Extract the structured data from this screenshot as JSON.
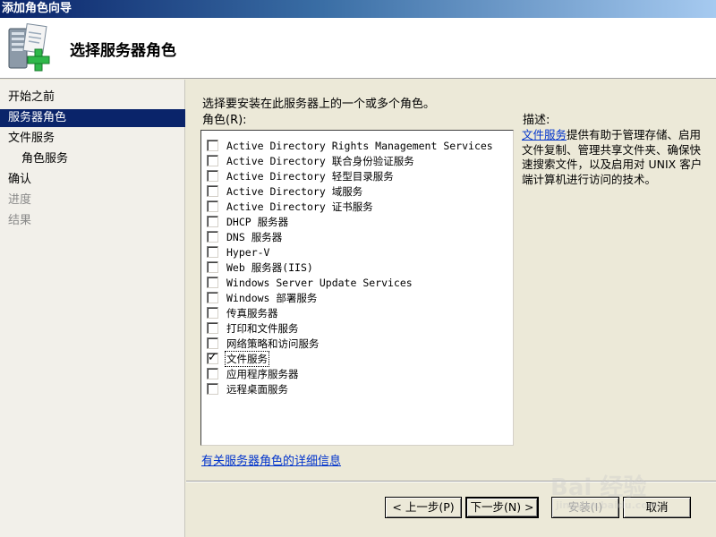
{
  "window": {
    "title": "添加角色向导"
  },
  "header": {
    "title": "选择服务器角色"
  },
  "sidebar": {
    "items": [
      {
        "label": "开始之前",
        "state": "normal"
      },
      {
        "label": "服务器角色",
        "state": "active"
      },
      {
        "label": "文件服务",
        "state": "normal"
      },
      {
        "label": "角色服务",
        "state": "normal"
      },
      {
        "label": "确认",
        "state": "normal"
      },
      {
        "label": "进度",
        "state": "disabled"
      },
      {
        "label": "结果",
        "state": "disabled"
      }
    ]
  },
  "main": {
    "instruction": "选择要安装在此服务器上的一个或多个角色。",
    "roles_label": "角色(R):",
    "roles": [
      {
        "label": "Active Directory Rights Management Services",
        "checked": false
      },
      {
        "label": "Active Directory 联合身份验证服务",
        "checked": false
      },
      {
        "label": "Active Directory 轻型目录服务",
        "checked": false
      },
      {
        "label": "Active Directory 域服务",
        "checked": false
      },
      {
        "label": "Active Directory 证书服务",
        "checked": false
      },
      {
        "label": "DHCP 服务器",
        "checked": false
      },
      {
        "label": "DNS 服务器",
        "checked": false
      },
      {
        "label": "Hyper-V",
        "checked": false
      },
      {
        "label": "Web 服务器(IIS)",
        "checked": false
      },
      {
        "label": "Windows Server Update Services",
        "checked": false
      },
      {
        "label": "Windows 部署服务",
        "checked": false
      },
      {
        "label": "传真服务器",
        "checked": false
      },
      {
        "label": "打印和文件服务",
        "checked": false
      },
      {
        "label": "网络策略和访问服务",
        "checked": false
      },
      {
        "label": "文件服务",
        "checked": true
      },
      {
        "label": "应用程序服务器",
        "checked": false
      },
      {
        "label": "远程桌面服务",
        "checked": false
      }
    ],
    "more_info_link": "有关服务器角色的详细信息",
    "description": {
      "title": "描述:",
      "link_text": "文件服务",
      "text": "提供有助于管理存储、启用文件复制、管理共享文件夹、确保快速搜索文件，以及启用对 UNIX 客户端计算机进行访问的技术。"
    }
  },
  "buttons": {
    "previous": "< 上一步(P)",
    "next": "下一步(N) >",
    "install": "安装(I)",
    "cancel": "取消"
  },
  "watermark": {
    "brand": "Bai 经验",
    "url": "jingyan.baidu.com"
  },
  "colors": {
    "accent": "#0a246a",
    "link": "#0033cc",
    "icon_plus": "#2fb84a"
  }
}
